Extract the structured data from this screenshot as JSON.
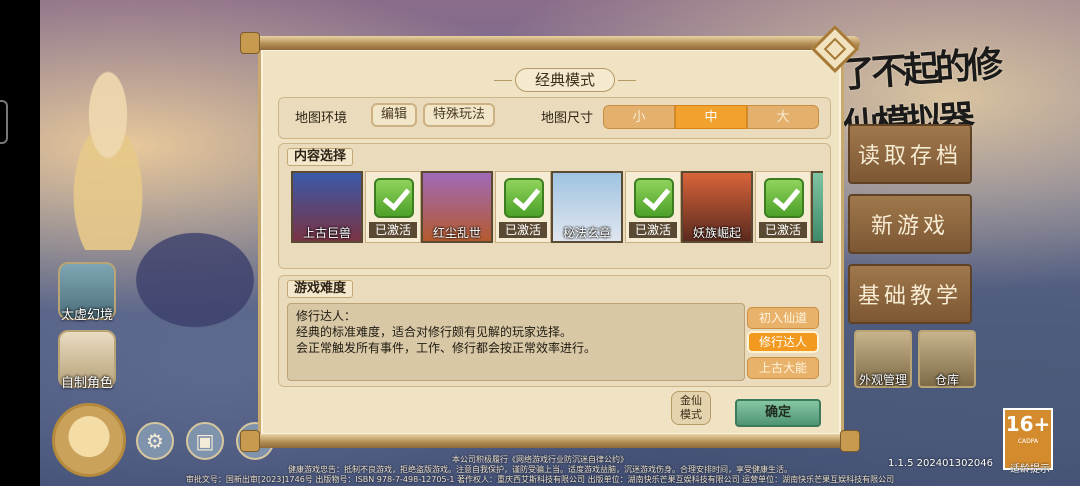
{
  "dialog": {
    "title": "经典模式",
    "map_env_label": "地图环境",
    "edit_button": "编辑",
    "special_button": "特殊玩法",
    "map_size_label": "地图尺寸",
    "map_sizes": [
      "小",
      "中",
      "大"
    ],
    "map_size_selected": "中",
    "content_section": "内容选择",
    "contents": [
      {
        "name": "上古巨兽",
        "state": "已激活"
      },
      {
        "name": "红尘乱世",
        "state": "已激活"
      },
      {
        "name": "秘法玄章",
        "state": "已激活"
      },
      {
        "name": "妖族崛起",
        "state": "已激活"
      }
    ],
    "difficulty_section": "游戏难度",
    "difficulty_text": [
      "修行达人：",
      "经典的标准难度，适合对修行颇有见解的玩家选择。",
      "会正常触发所有事件，工作、修行都会按正常效率进行。"
    ],
    "difficulties": [
      "初入仙道",
      "修行达人",
      "上古大能"
    ],
    "difficulty_selected": "修行达人",
    "mode_badge": "金仙\n模式",
    "confirm_button": "确定"
  },
  "left_menu": {
    "items": [
      "太虚幻境",
      "自制角色"
    ]
  },
  "right_menu": {
    "logo": "了不起的修仙模拟器",
    "buttons": [
      "读取存档",
      "新游戏",
      "基础教学"
    ],
    "tiles": [
      "外观管理",
      "仓库"
    ]
  },
  "age_rating": {
    "big": "16+",
    "small": "CADPA",
    "tip": "适龄提示"
  },
  "version": "1.1.5 202401302046",
  "footer": {
    "line1": "本公司积极履行《网络游戏行业防沉迷自律公约》",
    "line2": "健康游戏忠告：抵制不良游戏，拒绝盗版游戏。注意自我保护，谨防受骗上当。适度游戏益脑，沉迷游戏伤身。合理安排时间，享受健康生活。",
    "line3": "审批文号：国新出审[2023]1746号 出版物号：ISBN 978-7-498-12705-1 著作权人：重庆西艾斯科技有限公司 出版单位：湖南快乐芒果互娱科技有限公司 运营单位：湖南快乐芒果互娱科技有限公司"
  },
  "colors": {
    "dialog_bg": "#efe3c4",
    "accent_orange": "#f0a12e",
    "confirm_green": "#4f9472",
    "check_green": "#4da129"
  }
}
